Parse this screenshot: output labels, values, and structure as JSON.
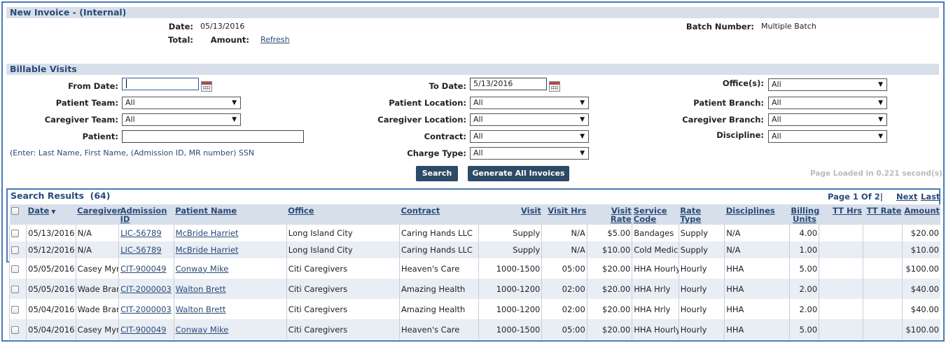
{
  "header": {
    "title": "New Invoice - (Internal)",
    "date_label": "Date:",
    "date_value": "05/13/2016",
    "total_label": "Total:",
    "amount_label": "Amount:",
    "refresh_link": "Refresh",
    "batch_label": "Batch Number:",
    "batch_value": "Multiple Batch"
  },
  "filters": {
    "title": "Billable Visits",
    "from_date_label": "From Date:",
    "from_date_value": "",
    "to_date_label": "To Date:",
    "to_date_value": "5/13/2016",
    "offices_label": "Office(s):",
    "offices_value": "All",
    "patient_team_label": "Patient Team:",
    "patient_team_value": "All",
    "patient_location_label": "Patient Location:",
    "patient_location_value": "All",
    "patient_branch_label": "Patient Branch:",
    "patient_branch_value": "All",
    "caregiver_team_label": "Caregiver Team:",
    "caregiver_team_value": "All",
    "caregiver_location_label": "Caregiver Location:",
    "caregiver_location_value": "All",
    "caregiver_branch_label": "Caregiver Branch:",
    "caregiver_branch_value": "All",
    "patient_label": "Patient:",
    "patient_value": "",
    "contract_label": "Contract:",
    "contract_value": "All",
    "discipline_label": "Discipline:",
    "discipline_value": "All",
    "charge_type_label": "Charge Type:",
    "charge_type_value": "All",
    "hint": "(Enter: Last Name, First Name, (Admission ID, MR number) SSN",
    "search_button": "Search",
    "generate_button": "Generate All Invoices",
    "page_loaded": "Page Loaded in 0.221 second(s)."
  },
  "results": {
    "title": "Search Results",
    "count": "(64)",
    "page_info": "Page 1 Of 2|",
    "next": "Next",
    "last": "Last",
    "columns": {
      "date": "Date",
      "caregiver": "Caregiver",
      "admission_id": "Admission ID",
      "patient_name": "Patient Name",
      "office": "Office",
      "contract": "Contract",
      "visit": "Visit",
      "visit_hrs": "Visit Hrs",
      "visit_rate": "Visit Rate",
      "service_code": "Service Code",
      "rate_type": "Rate Type",
      "disciplines": "Disciplines",
      "billing_units": "Billing Units",
      "tt_hrs": "TT Hrs",
      "tt_rate": "TT Rate",
      "amount": "Amount"
    },
    "rows": [
      {
        "date": "05/13/2016",
        "caregiver": "N/A",
        "admission_id": "LIC-56789",
        "patient_name": "McBride Harriet",
        "office": "Long Island City",
        "contract": "Caring Hands LLC",
        "visit": "Supply",
        "visit_hrs": "N/A",
        "visit_rate": "$5.00",
        "service_code": "Bandages",
        "rate_type": "Supply",
        "disciplines": "N/A",
        "billing_units": "4.00",
        "tt_hrs": "",
        "tt_rate": "",
        "amount": "$20.00"
      },
      {
        "date": "05/12/2016",
        "caregiver": "N/A",
        "admission_id": "LIC-56789",
        "patient_name": "McBride Harriet",
        "office": "Long Island City",
        "contract": "Caring Hands LLC",
        "visit": "Supply",
        "visit_hrs": "N/A",
        "visit_rate": "$10.00",
        "service_code": "Cold Medicine",
        "rate_type": "Supply",
        "disciplines": "N/A",
        "billing_units": "1.00",
        "tt_hrs": "",
        "tt_rate": "",
        "amount": "$10.00"
      },
      {
        "date": "05/05/2016",
        "caregiver": "Casey Myra",
        "admission_id": "CIT-900049",
        "patient_name": "Conway Mike",
        "office": "Citi Caregivers",
        "contract": "Heaven's Care",
        "visit": "1000-1500",
        "visit_hrs": "05:00",
        "visit_rate": "$20.00",
        "service_code": "HHA Hourly Reg",
        "rate_type": "Hourly",
        "disciplines": "HHA",
        "billing_units": "5.00",
        "tt_hrs": "",
        "tt_rate": "",
        "amount": "$100.00"
      },
      {
        "date": "05/05/2016",
        "caregiver": "Wade Brandy",
        "admission_id": "CIT-2000003",
        "patient_name": "Walton Brett",
        "office": "Citi Caregivers",
        "contract": "Amazing Health",
        "visit": "1000-1200",
        "visit_hrs": "02:00",
        "visit_rate": "$20.00",
        "service_code": "HHA Hrly",
        "rate_type": "Hourly",
        "disciplines": "HHA",
        "billing_units": "2.00",
        "tt_hrs": "",
        "tt_rate": "",
        "amount": "$40.00"
      },
      {
        "date": "05/04/2016",
        "caregiver": "Wade Brandy",
        "admission_id": "CIT-2000003",
        "patient_name": "Walton Brett",
        "office": "Citi Caregivers",
        "contract": "Amazing Health",
        "visit": "1000-1200",
        "visit_hrs": "02:00",
        "visit_rate": "$20.00",
        "service_code": "HHA Hrly",
        "rate_type": "Hourly",
        "disciplines": "HHA",
        "billing_units": "2.00",
        "tt_hrs": "",
        "tt_rate": "",
        "amount": "$40.00"
      },
      {
        "date": "05/04/2016",
        "caregiver": "Casey Myra",
        "admission_id": "CIT-900049",
        "patient_name": "Conway Mike",
        "office": "Citi Caregivers",
        "contract": "Heaven's Care",
        "visit": "1000-1500",
        "visit_hrs": "05:00",
        "visit_rate": "$20.00",
        "service_code": "HHA Hourly Reg",
        "rate_type": "Hourly",
        "disciplines": "HHA",
        "billing_units": "5.00",
        "tt_hrs": "",
        "tt_rate": "",
        "amount": "$100.00"
      }
    ]
  }
}
